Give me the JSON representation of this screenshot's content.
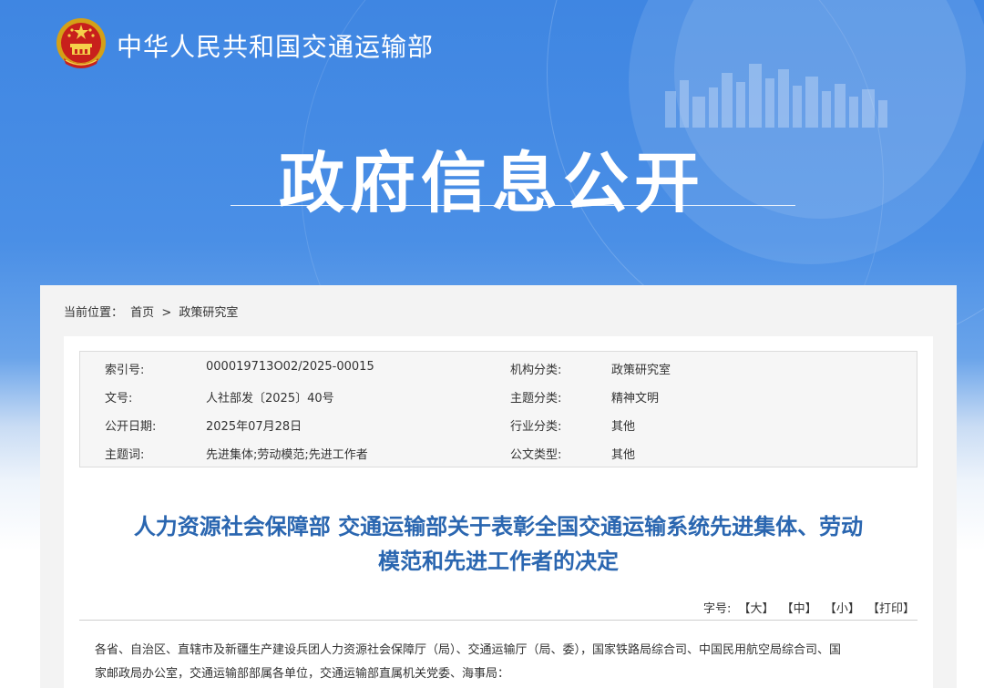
{
  "header": {
    "ministry_name": "中华人民共和国交通运输部",
    "hero_title": "政府信息公开"
  },
  "breadcrumb": {
    "prefix": "当前位置：",
    "home": "首页",
    "separator": ">",
    "current": "政策研究室"
  },
  "meta": {
    "rows": [
      {
        "label1": "索引号:",
        "value1": "000019713O02/2025-00015",
        "label2": "机构分类:",
        "value2": "政策研究室"
      },
      {
        "label1": "文号:",
        "value1": "人社部发〔2025〕40号",
        "label2": "主题分类:",
        "value2": "精神文明"
      },
      {
        "label1": "公开日期:",
        "value1": "2025年07月28日",
        "label2": "行业分类:",
        "value2": "其他"
      },
      {
        "label1": "主题词:",
        "value1": "先进集体;劳动模范;先进工作者",
        "label2": "公文类型:",
        "value2": "其他"
      }
    ]
  },
  "document": {
    "title_line1": "人力资源社会保障部 交通运输部关于表彰全国交通运输系统先进集体、劳动",
    "title_line2": "模范和先进工作者的决定",
    "font_size_label": "字号:",
    "font_large": "【大】",
    "font_medium": "【中】",
    "font_small": "【小】",
    "print": "【打印】",
    "body_line1": "各省、自治区、直辖市及新疆生产建设兵团人力资源社会保障厅（局）、交通运输厅（局、委），国家铁路局综合司、中国民用航空局综合司、国",
    "body_line2": "家邮政局办公室，交通运输部部属各单位，交通运输部直属机关党委、海事局："
  },
  "colors": {
    "banner_blue": "#3f86e2",
    "title_blue": "#2a66b0"
  }
}
